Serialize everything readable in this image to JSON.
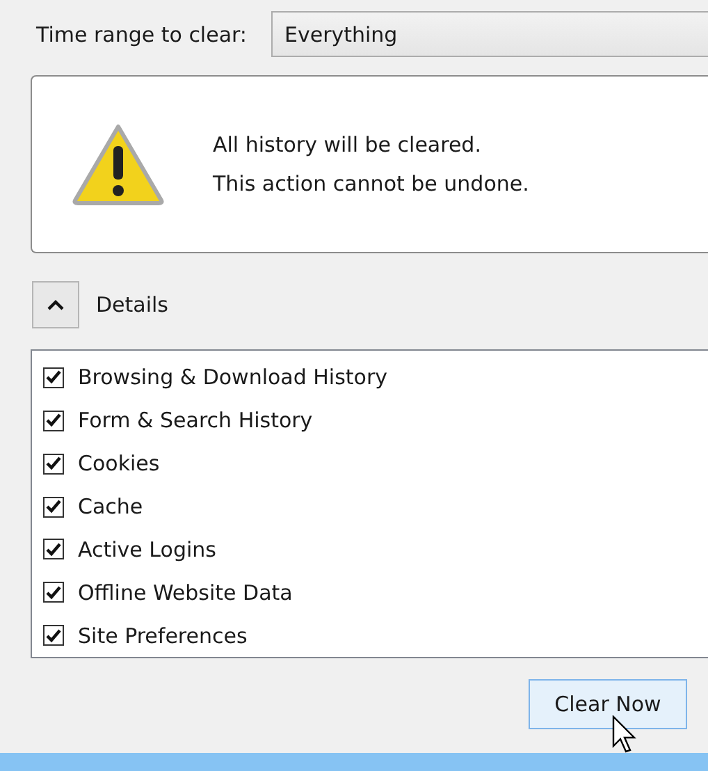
{
  "time_range": {
    "label": "Time range to clear:",
    "value": "Everything"
  },
  "warning": {
    "lines": [
      "All history will be cleared.",
      "This action cannot be undone."
    ]
  },
  "details": {
    "label": "Details",
    "expanded": true
  },
  "items": [
    {
      "label": "Browsing & Download History",
      "checked": true
    },
    {
      "label": "Form & Search History",
      "checked": true
    },
    {
      "label": "Cookies",
      "checked": true
    },
    {
      "label": "Cache",
      "checked": true
    },
    {
      "label": "Active Logins",
      "checked": true
    },
    {
      "label": "Offline Website Data",
      "checked": true
    },
    {
      "label": "Site Preferences",
      "checked": true
    }
  ],
  "buttons": [
    "Clear Now"
  ]
}
